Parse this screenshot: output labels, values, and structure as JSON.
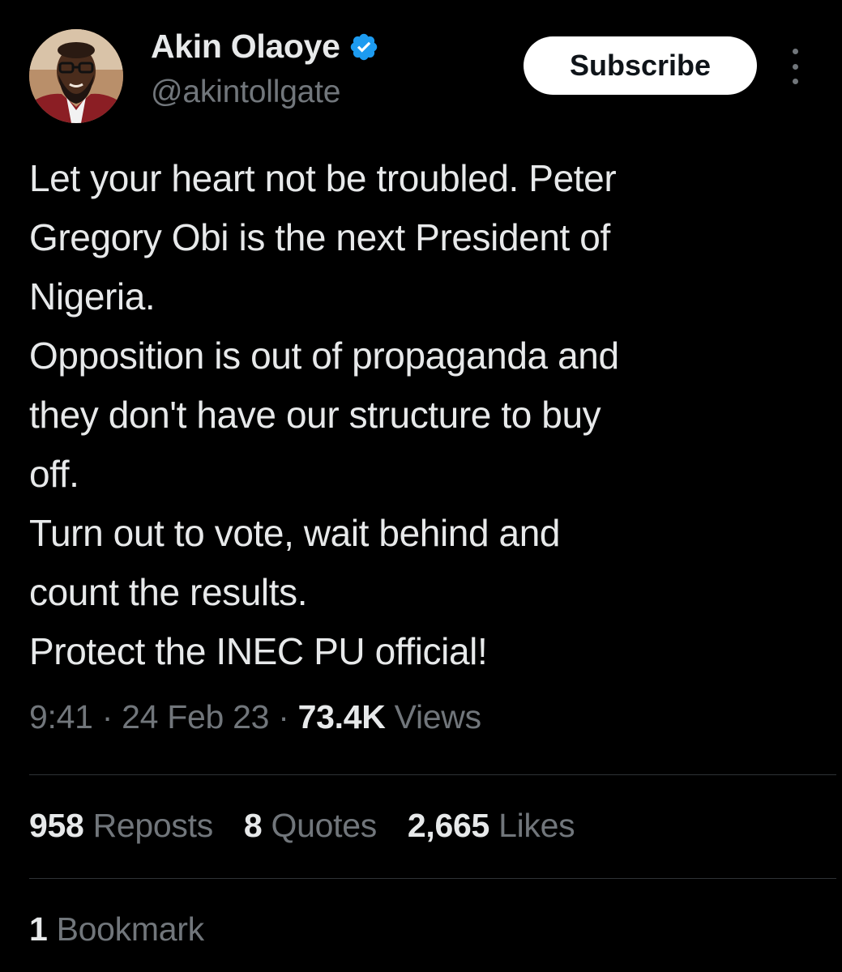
{
  "author": {
    "display_name": "Akin Olaoye",
    "handle": "@akintollgate",
    "verified": true,
    "avatar": "profile-photo"
  },
  "header": {
    "subscribe_label": "Subscribe",
    "more_icon": "more-vertical-icon"
  },
  "tweet": {
    "lines": [
      "Let your heart not be troubled. Peter",
      "Gregory Obi is the next President of",
      "Nigeria.",
      "Opposition is out of propaganda and",
      "they don't have our structure to buy",
      "off.",
      "Turn out to vote, wait behind and",
      "count the results.",
      "Protect the INEC PU official!"
    ]
  },
  "meta": {
    "time": "9:41",
    "date": "24 Feb 23",
    "views_count": "73.4K",
    "views_label": "Views",
    "separator": "·"
  },
  "stats": {
    "reposts_count": "958",
    "reposts_label": "Reposts",
    "quotes_count": "8",
    "quotes_label": "Quotes",
    "likes_count": "2,665",
    "likes_label": "Likes"
  },
  "bookmarks": {
    "count": "1",
    "label": "Bookmark"
  },
  "colors": {
    "background": "#000000",
    "primary_text": "#e7e9ea",
    "secondary_text": "#71767b",
    "verified_blue": "#1d9bf0",
    "divider": "#2f3336",
    "subscribe_bg": "#ffffff"
  }
}
